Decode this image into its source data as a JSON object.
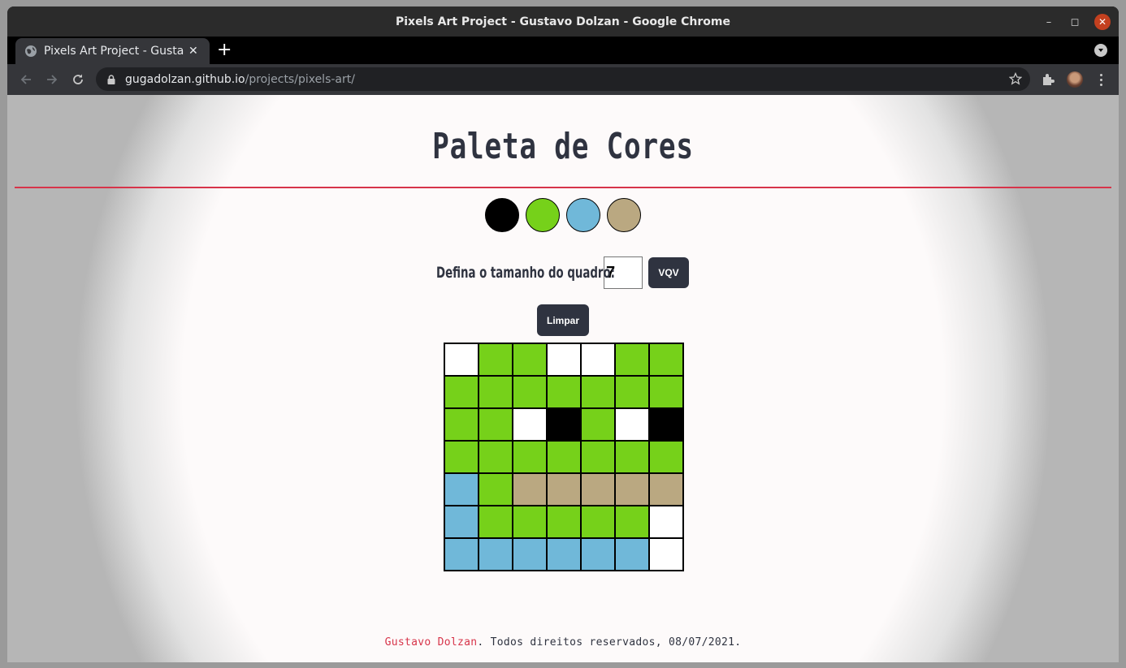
{
  "window": {
    "title": "Pixels Art Project - Gustavo Dolzan - Google Chrome",
    "minimize": "–",
    "maximize": "◻",
    "close": "✕"
  },
  "tab": {
    "label": "Pixels Art Project - Gustavo Dolzan",
    "close": "✕",
    "new_tab": "+"
  },
  "toolbar": {
    "url_host": "gugadolzan.github.io",
    "url_path": "/projects/pixels-art/"
  },
  "page": {
    "title": "Paleta de Cores",
    "palette": [
      "#000000",
      "#76d11a",
      "#70b8d9",
      "#baa881"
    ],
    "size_label": "Defina o tamanho do quadro:",
    "size_value": "7",
    "vqv_label": "VQV",
    "clear_label": "Limpar",
    "board": [
      [
        "#ffffff",
        "#76d11a",
        "#76d11a",
        "#ffffff",
        "#ffffff",
        "#76d11a",
        "#76d11a"
      ],
      [
        "#76d11a",
        "#76d11a",
        "#76d11a",
        "#76d11a",
        "#76d11a",
        "#76d11a",
        "#76d11a"
      ],
      [
        "#76d11a",
        "#76d11a",
        "#ffffff",
        "#000000",
        "#76d11a",
        "#ffffff",
        "#000000"
      ],
      [
        "#76d11a",
        "#76d11a",
        "#76d11a",
        "#76d11a",
        "#76d11a",
        "#76d11a",
        "#76d11a"
      ],
      [
        "#70b8d9",
        "#76d11a",
        "#baa881",
        "#baa881",
        "#baa881",
        "#baa881",
        "#baa881"
      ],
      [
        "#70b8d9",
        "#76d11a",
        "#76d11a",
        "#76d11a",
        "#76d11a",
        "#76d11a",
        "#ffffff"
      ],
      [
        "#70b8d9",
        "#70b8d9",
        "#70b8d9",
        "#70b8d9",
        "#70b8d9",
        "#70b8d9",
        "#ffffff"
      ]
    ],
    "footer": {
      "author": "Gustavo Dolzan",
      "rest": ". Todos direitos reservados, 08/07/2021."
    }
  },
  "colors": {
    "accent": "#d7344a",
    "button": "#2f3340"
  }
}
